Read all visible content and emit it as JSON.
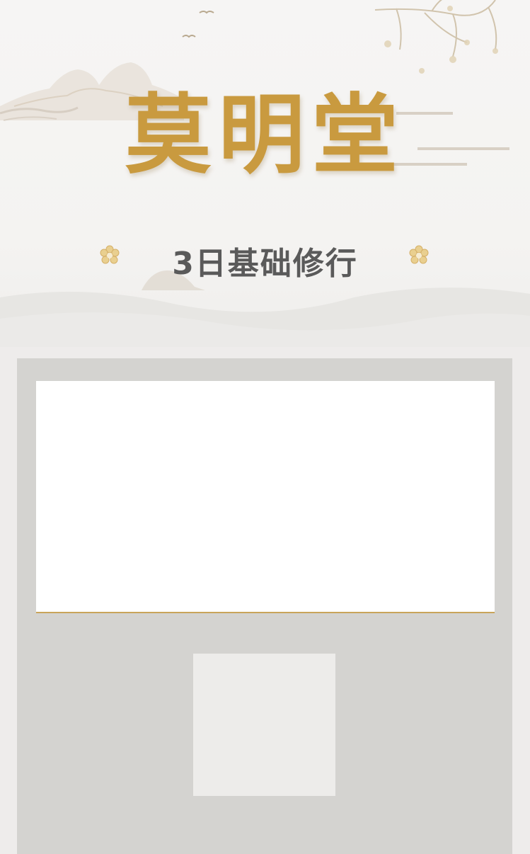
{
  "header": {
    "title": "莫明堂",
    "subtitle": "3日基础修行"
  },
  "icons": {
    "flower_left": "flower-ornament-icon",
    "flower_right": "flower-ornament-icon"
  },
  "colors": {
    "title_gold": "#c99a3f",
    "subtitle_gray": "#5a5a5a",
    "panel_gray": "#d4d3d0",
    "card_white": "#ffffff",
    "card_border_gold": "#c9a45a",
    "thumb_placeholder": "#edecea"
  }
}
